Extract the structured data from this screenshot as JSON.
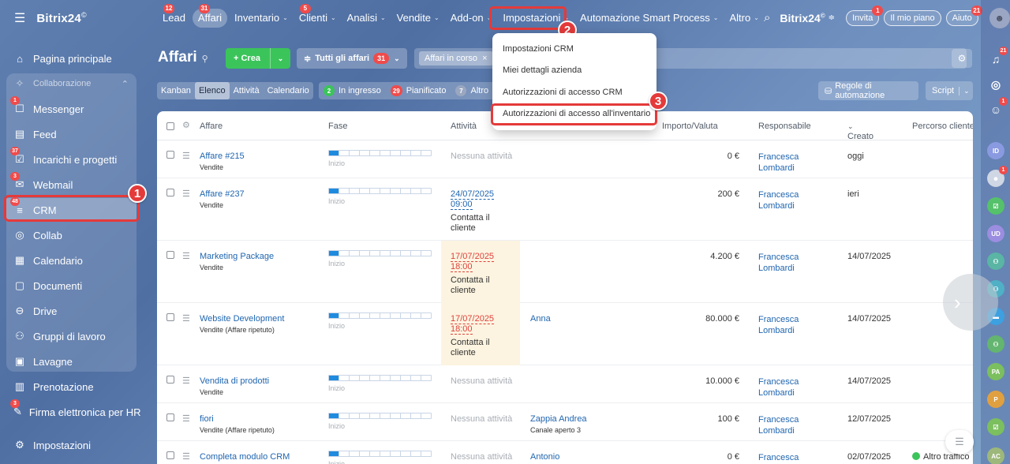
{
  "app": {
    "logo": "Bitrix24",
    "logo_sup": "©"
  },
  "sidebar": {
    "items": [
      {
        "label": "Pagina principale",
        "icon": "home-icon",
        "glyph": "⌂"
      },
      {
        "label": "Collaborazione",
        "icon": "collab-section-icon",
        "glyph": "✧",
        "chevron": "⌃"
      },
      {
        "label": "Messenger",
        "icon": "messenger-icon",
        "glyph": "☐",
        "badge": "1"
      },
      {
        "label": "Feed",
        "icon": "feed-icon",
        "glyph": "▤"
      },
      {
        "label": "Incarichi e progetti",
        "icon": "tasks-icon",
        "glyph": "☑",
        "badge": "37"
      },
      {
        "label": "Webmail",
        "icon": "mail-icon",
        "glyph": "✉",
        "badge": "3"
      },
      {
        "label": "CRM",
        "icon": "crm-icon",
        "glyph": "≡",
        "badge": "48"
      },
      {
        "label": "Collab",
        "icon": "collab-icon",
        "glyph": "◎"
      },
      {
        "label": "Calendario",
        "icon": "calendar-icon",
        "glyph": "▦"
      },
      {
        "label": "Documenti",
        "icon": "documents-icon",
        "glyph": "▢"
      },
      {
        "label": "Drive",
        "icon": "drive-icon",
        "glyph": "⊖"
      },
      {
        "label": "Gruppi di lavoro",
        "icon": "groups-icon",
        "glyph": "⚇"
      },
      {
        "label": "Lavagne",
        "icon": "boards-icon",
        "glyph": "▣"
      },
      {
        "label": "Prenotazione",
        "icon": "booking-icon",
        "glyph": "▥"
      },
      {
        "label": "Firma elettronica per HR",
        "icon": "esign-icon",
        "glyph": "✎",
        "badge": "3"
      },
      {
        "label": "Impostazioni",
        "icon": "settings-icon",
        "glyph": "⚙"
      }
    ]
  },
  "topnav": {
    "items": [
      {
        "label": "Lead",
        "badge": "12"
      },
      {
        "label": "Affari",
        "badge": "31",
        "active": true
      },
      {
        "label": "Inventario",
        "chevron": "⌄"
      },
      {
        "label": "Clienti",
        "chevron": "⌄",
        "badge": "5"
      },
      {
        "label": "Analisi",
        "chevron": "⌄"
      },
      {
        "label": "Vendite",
        "chevron": "⌄"
      },
      {
        "label": "Add-on",
        "chevron": "⌄"
      },
      {
        "label": "Impostazioni",
        "chevron": "⌄"
      },
      {
        "label": "Automazione Smart Process",
        "chevron": "⌄"
      },
      {
        "label": "Altro",
        "chevron": "⌄"
      }
    ],
    "search_glyph": "⌕",
    "right": {
      "logo": "Bitrix24",
      "invite": "Invita",
      "invite_badge": "1",
      "plan": "Il mio piano",
      "help": "Aiuto",
      "help_badge": "21"
    }
  },
  "header": {
    "title": "Affari",
    "create": "+ Crea",
    "filter": "Tutti gli affari",
    "filter_badge": "31",
    "chip": "Affari in corso",
    "chip_close": "×"
  },
  "views": [
    "Kanban",
    "Elenco",
    "Attività",
    "Calendario"
  ],
  "counters": [
    {
      "num": "2",
      "label": "In ingresso",
      "color": "#3bc45a"
    },
    {
      "num": "29",
      "label": "Pianificato",
      "color": "#f04b4b"
    },
    {
      "num": "7",
      "label": "Altro",
      "color": "#9aa7c0"
    }
  ],
  "toolbar": {
    "rules": "Regole di automazione",
    "script": "Script"
  },
  "table": {
    "columns": {
      "deal": "Affare",
      "stage": "Fase",
      "activity": "Attività",
      "amount": "Importo/Valuta",
      "responsible": "Responsabile",
      "created": "Creato",
      "route": "Percorso cliente"
    },
    "rows": [
      {
        "name": "Affare #215",
        "pipeline": "Vendite",
        "stage": "Inizio",
        "activity": "Nessuna attività",
        "contact": "",
        "contact_sub": "",
        "amount": "0 €",
        "resp1": "Francesca",
        "resp2": "Lombardi",
        "created": "oggi",
        "route": ""
      },
      {
        "name": "Affare #237",
        "pipeline": "Vendite",
        "stage": "Inizio",
        "act_date": "24/07/2025",
        "act_time": "09:00",
        "act_note1": "Contatta il",
        "act_note2": "cliente",
        "contact": "",
        "contact_sub": "",
        "amount": "200 €",
        "resp1": "Francesca",
        "resp2": "Lombardi",
        "created": "ieri",
        "route": ""
      },
      {
        "name": "Marketing Package",
        "pipeline": "Vendite",
        "stage": "Inizio",
        "act_date": "17/07/2025",
        "act_time": "18:00",
        "act_note1": "Contatta il",
        "act_note2": "cliente",
        "contact": "",
        "contact_sub": "",
        "amount": "4.200 €",
        "resp1": "Francesca",
        "resp2": "Lombardi",
        "created": "14/07/2025",
        "route": ""
      },
      {
        "name": "Website Development",
        "pipeline": "Vendite (Affare ripetuto)",
        "stage": "Inizio",
        "act_date": "17/07/2025",
        "act_time": "18:00",
        "act_note1": "Contatta il",
        "act_note2": "cliente",
        "contact": "Anna",
        "contact_sub": "",
        "amount": "80.000 €",
        "resp1": "Francesca",
        "resp2": "Lombardi",
        "created": "14/07/2025",
        "route": ""
      },
      {
        "name": "Vendita di prodotti",
        "pipeline": "Vendite",
        "stage": "Inizio",
        "activity": "Nessuna attività",
        "contact": "",
        "contact_sub": "",
        "amount": "10.000 €",
        "resp1": "Francesca",
        "resp2": "Lombardi",
        "created": "14/07/2025",
        "route": ""
      },
      {
        "name": "fiori",
        "pipeline": "Vendite (Affare ripetuto)",
        "stage": "Inizio",
        "activity": "Nessuna attività",
        "contact": "Zappia Andrea",
        "contact_sub": "Canale aperto 3",
        "amount": "100 €",
        "resp1": "Francesca",
        "resp2": "Lombardi",
        "created": "12/07/2025",
        "route": ""
      },
      {
        "name": "Completa modulo CRM",
        "pipeline": "",
        "stage": "Inizio",
        "activity": "Nessuna attività",
        "contact": "Antonio",
        "contact_sub": "",
        "amount": "0 €",
        "resp1": "Francesca",
        "resp2": "",
        "created": "02/07/2025",
        "route": "Altro traffico"
      }
    ]
  },
  "dropdown": {
    "items": [
      "Impostazioni CRM",
      "Miei dettagli azienda",
      "Autorizzazioni di accesso CRM",
      "Autorizzazioni di accesso all'inventario"
    ]
  },
  "callouts": [
    "1",
    "2",
    "3"
  ],
  "rail": {
    "items": [
      {
        "icon": "bell-icon",
        "glyph": "♫",
        "badge": "21",
        "bg": "transparent"
      },
      {
        "icon": "copilot-icon",
        "glyph": "◎",
        "bg": "transparent"
      },
      {
        "icon": "chat-icon",
        "glyph": "☺",
        "badge": "1",
        "bg": "transparent"
      },
      {
        "icon": "avatar-id-icon",
        "glyph": "ID",
        "bg": "#8a9ae0"
      },
      {
        "icon": "avatar-photo-icon",
        "glyph": "☻",
        "badge": "1",
        "bg": "#cfd6e4"
      },
      {
        "icon": "task-icon",
        "glyph": "☑",
        "bg": "#55c16a"
      },
      {
        "icon": "avatar-ud-icon",
        "glyph": "UD",
        "bg": "#9b8de0"
      },
      {
        "icon": "group-icon",
        "glyph": "⚇",
        "bg": "#5ab5a4"
      },
      {
        "icon": "group-icon",
        "glyph": "⚇",
        "bg": "#4fb0c6"
      },
      {
        "icon": "chat-bubble-icon",
        "glyph": "▬",
        "bg": "#3da0e0"
      },
      {
        "icon": "group-icon",
        "glyph": "⚇",
        "bg": "#63b56f"
      },
      {
        "icon": "avatar-pa-icon",
        "glyph": "PA",
        "bg": "#7cbf5f"
      },
      {
        "icon": "avatar-p-icon",
        "glyph": "P",
        "bg": "#e0a040"
      },
      {
        "icon": "task-icon",
        "glyph": "☑",
        "bg": "#7cbf5f"
      },
      {
        "icon": "avatar-ac-icon",
        "glyph": "AC",
        "bg": "#9db87a"
      }
    ]
  },
  "colors": {
    "accent_green": "#3bc45a",
    "badge_red": "#f04b4b",
    "link_blue": "#2066b0",
    "annotation_red": "#e53a3a"
  }
}
